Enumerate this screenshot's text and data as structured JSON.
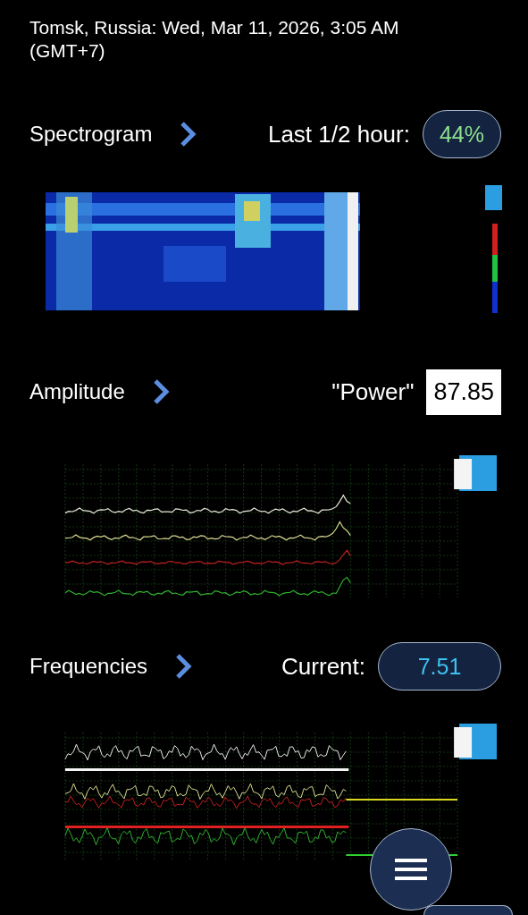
{
  "location_time": "Tomsk, Russia: Wed, Mar 11, 2026, 3:05 AM (GMT+7)",
  "sections": [
    {
      "title": "Spectrogram",
      "kind": "spectrogram",
      "reading_label": "Last 1/2 hour:",
      "reading": {
        "kind": "pill",
        "text": "44%"
      }
    },
    {
      "title": "Amplitude",
      "kind": "amplitude",
      "reading_label": "\"Power\"",
      "reading": {
        "kind": "box",
        "text": "87.85"
      }
    },
    {
      "title": "Frequencies",
      "kind": "frequencies",
      "reading_label": "Current:",
      "reading": {
        "kind": "pill",
        "text": "7.51"
      }
    }
  ]
}
